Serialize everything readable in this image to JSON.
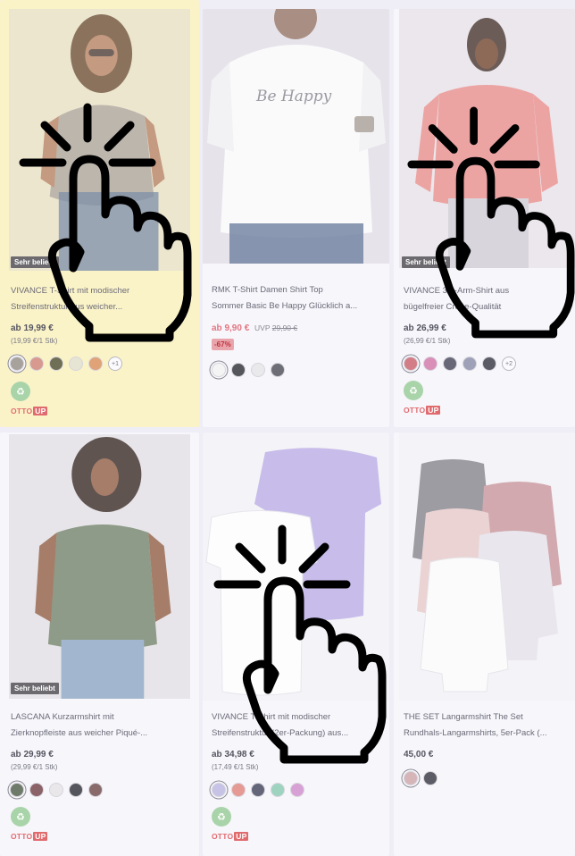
{
  "products": [
    {
      "badge": "Sehr beliebt",
      "title_line1": "VIVANCE T-Shirt mit modischer",
      "title_line2": "Streifenstruktur aus weicher...",
      "price": "ab 19,99 €",
      "unit_price": "(19,99 €/1 Stk)",
      "swatches": [
        "#a7a29b",
        "#d89a8e",
        "#6f6f55",
        "#e6e4d3",
        "#e0a378"
      ],
      "more": "+1",
      "eco": true,
      "otto_up": true
    },
    {
      "title_line1": "RMK T-Shirt Damen Shirt Top",
      "title_line2": "Sommer Basic Be Happy Glücklich a...",
      "price": "ab 9,90 €",
      "uvp_label": "UVP",
      "uvp_price": "29,90 €",
      "discount": "-67%",
      "swatches": [
        "#f4f4f4",
        "#55555c",
        "#e9e9ec",
        "#6e6e76"
      ],
      "print_text": "Be Happy"
    },
    {
      "badge": "Sehr beliebt",
      "title_line1": "VIVANCE 3/4-Arm-Shirt aus",
      "title_line2": "bügelfreier Crêpe-Qualität",
      "price": "ab 26,99 €",
      "unit_price": "(26,99 €/1 Stk)",
      "swatches": [
        "#d37d86",
        "#d98fb8",
        "#686878",
        "#9ea1b8",
        "#5b5b66"
      ],
      "more": "+2",
      "eco": true,
      "otto_up": true
    },
    {
      "badge": "Sehr beliebt",
      "title_line1": "LASCANA Kurzarmshirt mit",
      "title_line2": "Zierknopfleiste aus weicher Piqué-...",
      "price": "ab 29,99 €",
      "unit_price": "(29,99 €/1 Stk)",
      "swatches": [
        "#6f7b6a",
        "#8a6268",
        "#e9e7ea",
        "#55555e",
        "#8a6b6b"
      ],
      "eco": true,
      "otto_up": true
    },
    {
      "title_line1": "VIVANCE T-Shirt mit modischer",
      "title_line2": "Streifenstruktur (2er-Packung) aus...",
      "price": "ab 34,98 €",
      "unit_price": "(17,49 €/1 Stk)",
      "swatches": [
        "#c6c3e6",
        "#e59a93",
        "#65657a",
        "#9ed3c0",
        "#d8a1d6"
      ],
      "eco": true,
      "otto_up": true
    },
    {
      "title_line1": "THE SET Langarmshirt The Set",
      "title_line2": "Rundhals-Langarmshirts, 5er-Pack (...",
      "price": "45,00 €",
      "swatches": [
        "#d6b5b8",
        "#5c5c66"
      ]
    }
  ],
  "otto_brand": "OTTO",
  "otto_up_label": "UP"
}
